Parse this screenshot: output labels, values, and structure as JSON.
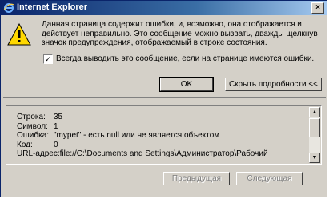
{
  "window": {
    "title": "Internet Explorer",
    "close_glyph": "×",
    "title_gradient": [
      "#0a246a",
      "#a6caf0"
    ]
  },
  "message": {
    "lines": [
      "Данная страница содержит ошибки, и, возможно, она отображается и",
      "действует неправильно. Это сообщение можно вызвать, дважды щелкнув",
      "значок предупреждения, отображаемый в строке состояния."
    ],
    "icon": "warning-triangle-icon"
  },
  "checkbox": {
    "checked": true,
    "mark": "✓",
    "label": "Всегда выводить это сообщение, если на странице имеются ошибки."
  },
  "buttons": {
    "ok": "OK",
    "details": "Скрыть подробности <<",
    "previous": "Предыдущая",
    "next": "Следующая"
  },
  "details": {
    "rows": [
      {
        "label": "Строка:",
        "value": "35"
      },
      {
        "label": "Символ:",
        "value": "1"
      },
      {
        "label": "Ошибка:",
        "value": "\"mypet\" - есть null или не является объектом"
      },
      {
        "label": "Код:",
        "value": "0"
      }
    ],
    "url": "URL-адрес:file://C:\\Documents and Settings\\Администратор\\Рабочий"
  }
}
